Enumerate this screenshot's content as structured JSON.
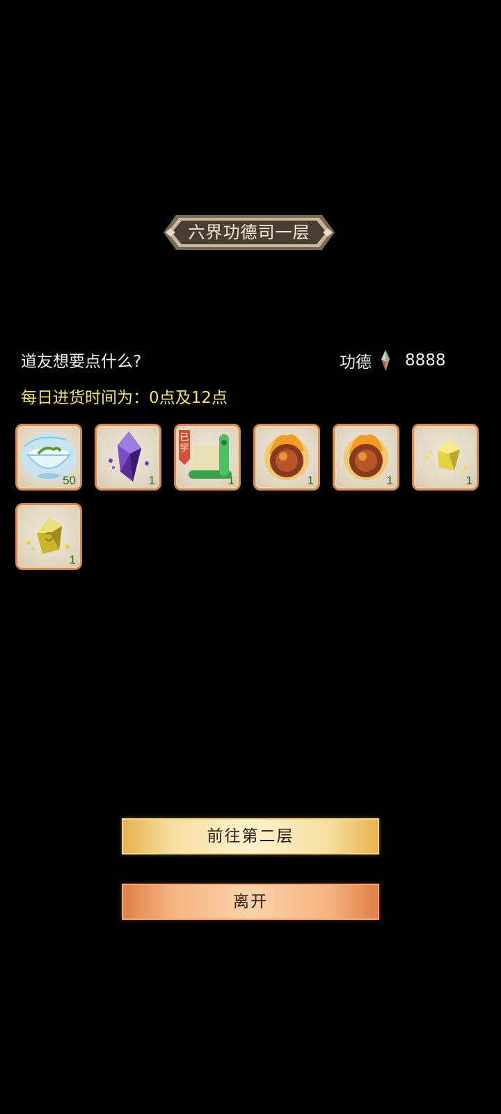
{
  "header": {
    "title": "六界功德司一层"
  },
  "shop": {
    "prompt": "道友想要点什么?",
    "merit_label": "功德",
    "merit_icon": "merit-crystal-icon",
    "merit_value": "8888",
    "restock_text": "每日进货时间为：0点及12点"
  },
  "items": [
    {
      "icon": "spirit-tea-cup-icon",
      "quantity": "50"
    },
    {
      "icon": "purple-crystal-icon",
      "quantity": "1"
    },
    {
      "icon": "learned-scroll-icon",
      "badge": "已学",
      "quantity": "1"
    },
    {
      "icon": "flaming-orb-icon",
      "quantity": "1"
    },
    {
      "icon": "flaming-orb-icon",
      "quantity": "1"
    },
    {
      "icon": "yellow-gem-small-icon",
      "quantity": "1"
    },
    {
      "icon": "yellow-gem-icon",
      "quantity": "1"
    }
  ],
  "buttons": {
    "next_floor": "前往第二层",
    "leave": "离开"
  },
  "colors": {
    "background": "#000000",
    "restock_text": "#f3e06a",
    "slot_border": "#d28a54",
    "quantity": "#2e6b21",
    "next_button": "#f6dfa2",
    "leave_button": "#f5b582"
  }
}
